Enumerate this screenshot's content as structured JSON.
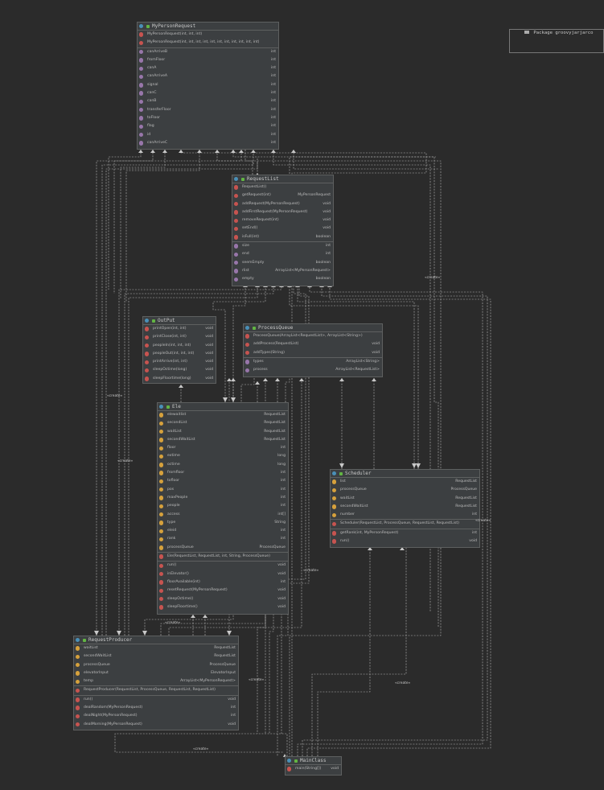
{
  "package": {
    "label": "Package groovyjarjarco"
  },
  "create_label": "«create»",
  "classes": {
    "MyPersonRequest": {
      "name": "MyPersonRequest",
      "members": [
        [
          {
            "n": "MyPersonRequest(int, int, int)",
            "t": "",
            "k": "m"
          },
          {
            "n": "MyPersonRequest(int, int, int, int, int, int, int, int, int, int, int)",
            "t": "",
            "k": "m"
          }
        ],
        [
          {
            "n": "canArriveB",
            "t": "int",
            "k": "p"
          },
          {
            "n": "fromFloor",
            "t": "int",
            "k": "p"
          },
          {
            "n": "canA",
            "t": "int",
            "k": "p"
          },
          {
            "n": "canArriveA",
            "t": "int",
            "k": "p"
          },
          {
            "n": "signal",
            "t": "int",
            "k": "p"
          },
          {
            "n": "canC",
            "t": "int",
            "k": "p"
          },
          {
            "n": "canB",
            "t": "int",
            "k": "p"
          },
          {
            "n": "transferFloor",
            "t": "int",
            "k": "p"
          },
          {
            "n": "toFloor",
            "t": "int",
            "k": "p"
          },
          {
            "n": "flag",
            "t": "int",
            "k": "p"
          },
          {
            "n": "id",
            "t": "int",
            "k": "p"
          },
          {
            "n": "canArriveC",
            "t": "int",
            "k": "p"
          }
        ]
      ]
    },
    "RequestList": {
      "name": "RequestList",
      "members": [
        [
          {
            "n": "RequestList()",
            "t": "",
            "k": "m"
          },
          {
            "n": "getRequest(int)",
            "t": "MyPersonRequest",
            "k": "m"
          },
          {
            "n": "addRequest(MyPersonRequest)",
            "t": "void",
            "k": "m"
          },
          {
            "n": "addFirstRequest(MyPersonRequest)",
            "t": "void",
            "k": "m"
          },
          {
            "n": "removeRequest(int)",
            "t": "void",
            "k": "m"
          },
          {
            "n": "setEnd()",
            "t": "void",
            "k": "m"
          },
          {
            "n": "isFull(int)",
            "t": "boolean",
            "k": "m"
          }
        ],
        [
          {
            "n": "size",
            "t": "int",
            "k": "p"
          },
          {
            "n": "end",
            "t": "int",
            "k": "p"
          },
          {
            "n": "seemEmpty",
            "t": "boolean",
            "k": "p"
          },
          {
            "n": "rlist",
            "t": "ArrayList<MyPersonRequest>",
            "k": "p"
          },
          {
            "n": "empty",
            "t": "boolean",
            "k": "p"
          }
        ]
      ]
    },
    "OutPut": {
      "name": "OutPut",
      "members": [
        [
          {
            "n": "printOpen(int, int)",
            "t": "void",
            "k": "m"
          },
          {
            "n": "printClose(int, int)",
            "t": "void",
            "k": "m"
          },
          {
            "n": "peopleIn(int, int, int)",
            "t": "void",
            "k": "m"
          },
          {
            "n": "peopleOut(int, int, int)",
            "t": "void",
            "k": "m"
          },
          {
            "n": "printArrive(int, int)",
            "t": "void",
            "k": "m"
          },
          {
            "n": "sleepOctime(long)",
            "t": "void",
            "k": "m"
          },
          {
            "n": "sleepFloortime(long)",
            "t": "void",
            "k": "m"
          }
        ]
      ]
    },
    "ProcessQueue": {
      "name": "ProcessQueue",
      "members": [
        [
          {
            "n": "ProcessQueue(ArrayList<RequestList>, ArrayList<String>)",
            "t": "",
            "k": "m"
          },
          {
            "n": "addProcess(RequestList)",
            "t": "void",
            "k": "m"
          },
          {
            "n": "addTypes(String)",
            "t": "void",
            "k": "m"
          }
        ],
        [
          {
            "n": "types",
            "t": "ArrayList<String>",
            "k": "p"
          },
          {
            "n": "process",
            "t": "ArrayList<RequestList>",
            "k": "p"
          }
        ]
      ]
    },
    "Ele": {
      "name": "Ele",
      "members": [
        [
          {
            "n": "elewaitlist",
            "t": "RequestList",
            "k": "f"
          },
          {
            "n": "secondList",
            "t": "RequestList",
            "k": "f"
          },
          {
            "n": "waitList",
            "t": "RequestList",
            "k": "f"
          },
          {
            "n": "secondWaitList",
            "t": "RequestList",
            "k": "f"
          },
          {
            "n": "floor",
            "t": "int",
            "k": "f"
          },
          {
            "n": "extime",
            "t": "long",
            "k": "f"
          },
          {
            "n": "octime",
            "t": "long",
            "k": "f"
          },
          {
            "n": "fromfloor",
            "t": "int",
            "k": "f"
          },
          {
            "n": "tofloor",
            "t": "int",
            "k": "f"
          },
          {
            "n": "pos",
            "t": "int",
            "k": "f"
          },
          {
            "n": "maxPeople",
            "t": "int",
            "k": "f"
          },
          {
            "n": "people",
            "t": "int",
            "k": "f"
          },
          {
            "n": "access",
            "t": "int[]",
            "k": "f"
          },
          {
            "n": "type",
            "t": "String",
            "k": "f"
          },
          {
            "n": "eleid",
            "t": "int",
            "k": "f"
          },
          {
            "n": "rank",
            "t": "int",
            "k": "f"
          },
          {
            "n": "processQueue",
            "t": "ProcessQueue",
            "k": "f"
          }
        ],
        [
          {
            "n": "Ele(RequestList, RequestList, int, String, ProcessQueue)",
            "t": "",
            "k": "m"
          }
        ],
        [
          {
            "n": "run()",
            "t": "void",
            "k": "m"
          },
          {
            "n": "inElevator()",
            "t": "void",
            "k": "m"
          },
          {
            "n": "floorAvailable(int)",
            "t": "int",
            "k": "m"
          },
          {
            "n": "resetRequest(MyPersonRequest)",
            "t": "void",
            "k": "m"
          },
          {
            "n": "sleepOctime()",
            "t": "void",
            "k": "m"
          },
          {
            "n": "sleepFloortime()",
            "t": "void",
            "k": "m"
          }
        ]
      ]
    },
    "Scheduler": {
      "name": "Scheduler",
      "members": [
        [
          {
            "n": "list",
            "t": "RequestList",
            "k": "f"
          },
          {
            "n": "processQueue",
            "t": "ProcessQueue",
            "k": "f"
          },
          {
            "n": "waitList",
            "t": "RequestList",
            "k": "f"
          },
          {
            "n": "secondWaitList",
            "t": "RequestList",
            "k": "f"
          },
          {
            "n": "number",
            "t": "int",
            "k": "f"
          }
        ],
        [
          {
            "n": "Scheduler(RequestList, ProcessQueue, RequestList, RequestList)",
            "t": "",
            "k": "m"
          }
        ],
        [
          {
            "n": "getRank(int, MyPersonRequest)",
            "t": "int",
            "k": "m"
          },
          {
            "n": "run()",
            "t": "void",
            "k": "m"
          }
        ]
      ]
    },
    "RequestProducer": {
      "name": "RequestProducer",
      "members": [
        [
          {
            "n": "waitList",
            "t": "RequestList",
            "k": "f"
          },
          {
            "n": "secondWaitList",
            "t": "RequestList",
            "k": "f"
          },
          {
            "n": "processQueue",
            "t": "ProcessQueue",
            "k": "f"
          },
          {
            "n": "elevatorInput",
            "t": "ElevatorInput",
            "k": "f"
          },
          {
            "n": "temp",
            "t": "ArrayList<MyPersonRequest>",
            "k": "f"
          }
        ],
        [
          {
            "n": "RequestProducer(RequestList, ProcessQueue, RequestList, RequestList)",
            "t": "",
            "k": "m"
          }
        ],
        [
          {
            "n": "run()",
            "t": "void",
            "k": "m"
          },
          {
            "n": "dealRandom(MyPersonRequest)",
            "t": "int",
            "k": "m"
          },
          {
            "n": "dealNight(MyPersonRequest)",
            "t": "int",
            "k": "m"
          },
          {
            "n": "dealMorning(MyPersonRequest)",
            "t": "void",
            "k": "m"
          }
        ]
      ]
    },
    "MainClass": {
      "name": "MainClass",
      "members": [
        [
          {
            "n": "main(String[])",
            "t": "void",
            "k": "m"
          }
        ]
      ]
    }
  }
}
